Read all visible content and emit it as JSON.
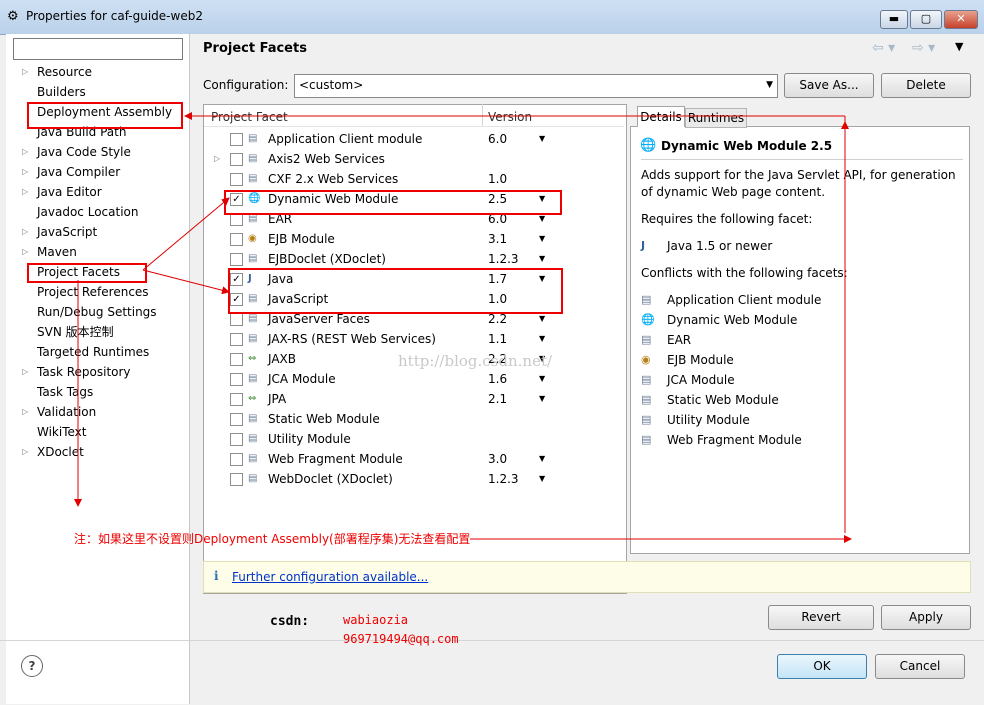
{
  "window": {
    "title": "Properties for caf-guide-web2",
    "min": "▬",
    "max": "▢",
    "close": "✕"
  },
  "nav": {
    "items": [
      {
        "label": "Resource",
        "expandable": true
      },
      {
        "label": "Builders",
        "expandable": false
      },
      {
        "label": "Deployment Assembly",
        "expandable": false
      },
      {
        "label": "Java Build Path",
        "expandable": false
      },
      {
        "label": "Java Code Style",
        "expandable": true
      },
      {
        "label": "Java Compiler",
        "expandable": true
      },
      {
        "label": "Java Editor",
        "expandable": true
      },
      {
        "label": "Javadoc Location",
        "expandable": false
      },
      {
        "label": "JavaScript",
        "expandable": true
      },
      {
        "label": "Maven",
        "expandable": true
      },
      {
        "label": "Project Facets",
        "expandable": false
      },
      {
        "label": "Project References",
        "expandable": false
      },
      {
        "label": "Run/Debug Settings",
        "expandable": false
      },
      {
        "label": "SVN 版本控制",
        "expandable": false
      },
      {
        "label": "Targeted Runtimes",
        "expandable": false
      },
      {
        "label": "Task Repository",
        "expandable": true
      },
      {
        "label": "Task Tags",
        "expandable": false
      },
      {
        "label": "Validation",
        "expandable": true
      },
      {
        "label": "WikiText",
        "expandable": false
      },
      {
        "label": "XDoclet",
        "expandable": true
      }
    ]
  },
  "page": {
    "title": "Project Facets",
    "configuration_label": "Configuration:",
    "configuration_value": "<custom>",
    "save_as": "Save As...",
    "delete": "Delete"
  },
  "facets": {
    "col_facet": "Project Facet",
    "col_version": "Version",
    "rows": [
      {
        "name": "Application Client module",
        "version": "6.0",
        "checked": false,
        "dropdown": true,
        "icon": "doc",
        "expand": false
      },
      {
        "name": "Axis2 Web Services",
        "version": "",
        "checked": false,
        "dropdown": false,
        "icon": "doc",
        "expand": true
      },
      {
        "name": "CXF 2.x Web Services",
        "version": "1.0",
        "checked": false,
        "dropdown": false,
        "icon": "doc",
        "expand": false
      },
      {
        "name": "Dynamic Web Module",
        "version": "2.5",
        "checked": true,
        "dropdown": true,
        "icon": "globe",
        "expand": false
      },
      {
        "name": "EAR",
        "version": "6.0",
        "checked": false,
        "dropdown": true,
        "icon": "doc",
        "expand": false
      },
      {
        "name": "EJB Module",
        "version": "3.1",
        "checked": false,
        "dropdown": true,
        "icon": "bean",
        "expand": false
      },
      {
        "name": "EJBDoclet (XDoclet)",
        "version": "1.2.3",
        "checked": false,
        "dropdown": true,
        "icon": "doc",
        "expand": false
      },
      {
        "name": "Java",
        "version": "1.7",
        "checked": true,
        "dropdown": true,
        "icon": "java",
        "expand": false
      },
      {
        "name": "JavaScript",
        "version": "1.0",
        "checked": true,
        "dropdown": false,
        "icon": "doc",
        "expand": false
      },
      {
        "name": "JavaServer Faces",
        "version": "2.2",
        "checked": false,
        "dropdown": true,
        "icon": "doc",
        "expand": false
      },
      {
        "name": "JAX-RS (REST Web Services)",
        "version": "1.1",
        "checked": false,
        "dropdown": true,
        "icon": "doc",
        "expand": false
      },
      {
        "name": "JAXB",
        "version": "2.2",
        "checked": false,
        "dropdown": true,
        "icon": "arrows",
        "expand": false
      },
      {
        "name": "JCA Module",
        "version": "1.6",
        "checked": false,
        "dropdown": true,
        "icon": "doc",
        "expand": false
      },
      {
        "name": "JPA",
        "version": "2.1",
        "checked": false,
        "dropdown": true,
        "icon": "arrows",
        "expand": false
      },
      {
        "name": "Static Web Module",
        "version": "",
        "checked": false,
        "dropdown": false,
        "icon": "doc",
        "expand": false
      },
      {
        "name": "Utility Module",
        "version": "",
        "checked": false,
        "dropdown": false,
        "icon": "doc",
        "expand": false
      },
      {
        "name": "Web Fragment Module",
        "version": "3.0",
        "checked": false,
        "dropdown": true,
        "icon": "doc",
        "expand": false
      },
      {
        "name": "WebDoclet (XDoclet)",
        "version": "1.2.3",
        "checked": false,
        "dropdown": true,
        "icon": "doc",
        "expand": false
      }
    ]
  },
  "details": {
    "tab_details": "Details",
    "tab_runtimes": "Runtimes",
    "heading": "Dynamic Web Module 2.5",
    "description": "Adds support for the Java Servlet API, for generation of dynamic Web page content.",
    "requires_label": "Requires the following facet:",
    "requires": [
      "Java 1.5 or newer"
    ],
    "conflicts_label": "Conflicts with the following facets:",
    "conflicts": [
      {
        "name": "Application Client module",
        "icon": "doc"
      },
      {
        "name": "Dynamic Web Module",
        "icon": "globe"
      },
      {
        "name": "EAR",
        "icon": "doc"
      },
      {
        "name": "EJB Module",
        "icon": "bean"
      },
      {
        "name": "JCA Module",
        "icon": "doc"
      },
      {
        "name": "Static Web Module",
        "icon": "doc"
      },
      {
        "name": "Utility Module",
        "icon": "doc"
      },
      {
        "name": "Web Fragment Module",
        "icon": "doc"
      }
    ]
  },
  "info": {
    "icon": "i",
    "link": "Further configuration available..."
  },
  "annotation": {
    "note": "注：如果这里不设置则Deployment Assembly(部署程序集)无法查看配置",
    "csdn_label": "csdn:",
    "csdn_user": "wabiaozia",
    "csdn_email": "969719494@qq.com",
    "watermark": "http://blog.csdn.net/"
  },
  "footer": {
    "revert": "Revert",
    "apply": "Apply",
    "ok": "OK",
    "cancel": "Cancel",
    "help": "?"
  },
  "colors": {
    "annotation_red": "#e00000",
    "title_bar": "#c4d8ee",
    "link": "#0033cc"
  }
}
